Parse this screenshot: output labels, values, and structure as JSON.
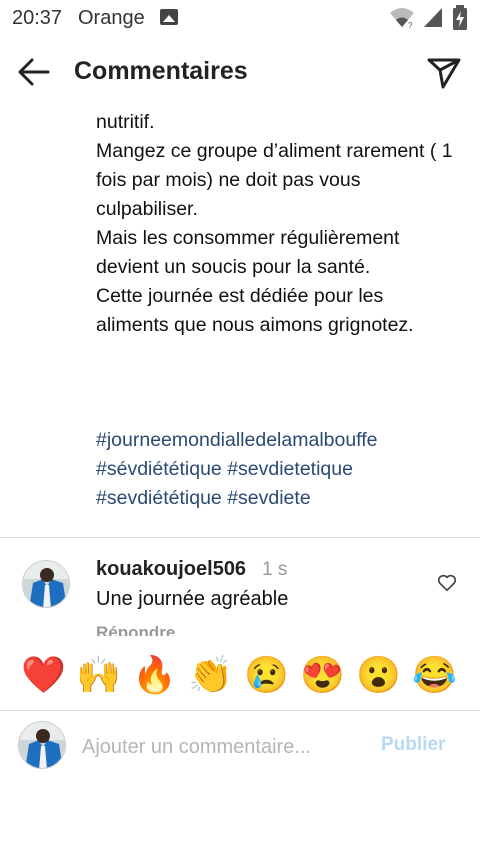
{
  "status_bar": {
    "time": "20:37",
    "carrier": "Orange",
    "icons": [
      "image-icon",
      "wifi-icon",
      "signal-icon",
      "battery-charging-icon"
    ]
  },
  "header": {
    "title": "Commentaires",
    "back_icon": "arrow-left-icon",
    "share_icon": "paper-plane-icon"
  },
  "caption": {
    "text": "nutritif.\nMangez ce groupe d’aliment rarement ( 1 fois par mois) ne doit pas vous culpabiliser.\nMais les consommer régulièrement devient un soucis pour la santé.\nCette journée est dédiée pour les aliments que nous aimons grignotez.",
    "hashtags": [
      "#journeemondialledelamalbouffe",
      "#sévdiététique",
      "#sevdietetique",
      "#sevdiététique",
      "#sevdiete"
    ]
  },
  "comment": {
    "username": "kouakoujoel506",
    "time": "1 s",
    "text": "Une journée agréable",
    "reply_label": "Répondre",
    "like_icon": "heart-outline-icon"
  },
  "emoji_bar": [
    "❤️",
    "🙌",
    "🔥",
    "👏",
    "😢",
    "😍",
    "😮",
    "😂"
  ],
  "compose": {
    "placeholder": "Ajouter un commentaire...",
    "value": "",
    "publish_label": "Publier"
  },
  "colors": {
    "hashtag": "#2a4a73",
    "publish_disabled": "#b8d9f5",
    "muted_text": "#999999",
    "divider": "#dcdcdc"
  }
}
